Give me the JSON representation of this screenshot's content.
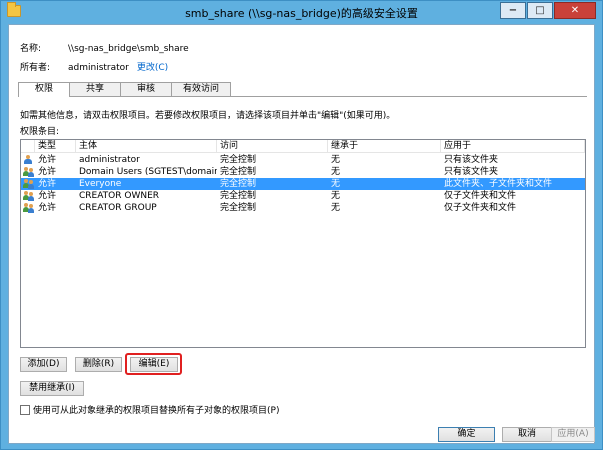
{
  "window": {
    "title": "smb_share (\\\\sg-nas_bridge)的高级安全设置",
    "minimize_label": "−",
    "maximize_label": "□",
    "close_label": "✕"
  },
  "info": {
    "name_label": "名称:",
    "name_value": "\\\\sg-nas_bridge\\smb_share",
    "owner_label": "所有者:",
    "owner_value": "administrator",
    "change_link": "更改(C)"
  },
  "tabs": [
    "权限",
    "共享",
    "审核",
    "有效访问"
  ],
  "active_tab": "权限",
  "instructions": "如需其他信息，请双击权限项目。若要修改权限项目，请选择该项目并单击\"编辑\"(如果可用)。",
  "entries_label": "权限条目:",
  "table": {
    "columns": [
      "类型",
      "主体",
      "访问",
      "继承于",
      "应用于"
    ],
    "rows": [
      {
        "icon": "user-icon",
        "type": "允许",
        "principal": "administrator",
        "access": "完全控制",
        "inherited": "无",
        "applies": "只有该文件夹"
      },
      {
        "icon": "group-icon",
        "type": "允许",
        "principal": "Domain Users (SGTEST\\domain ...",
        "access": "完全控制",
        "inherited": "无",
        "applies": "只有该文件夹"
      },
      {
        "icon": "group-icon",
        "type": "允许",
        "principal": "Everyone",
        "access": "完全控制",
        "inherited": "无",
        "applies": "此文件夹、子文件夹和文件",
        "selected": true
      },
      {
        "icon": "group-icon",
        "type": "允许",
        "principal": "CREATOR OWNER",
        "access": "完全控制",
        "inherited": "无",
        "applies": "仅子文件夹和文件"
      },
      {
        "icon": "group-icon",
        "type": "允许",
        "principal": "CREATOR GROUP",
        "access": "完全控制",
        "inherited": "无",
        "applies": "仅子文件夹和文件"
      }
    ]
  },
  "buttons": {
    "add": "添加(D)",
    "remove": "删除(R)",
    "edit": "编辑(E)",
    "disable_inheritance": "禁用继承(I)",
    "ok": "确定",
    "cancel": "取消",
    "apply": "应用(A)"
  },
  "replace_checkbox_label": "使用可从此对象继承的权限项目替换所有子对象的权限项目(P)",
  "colors": {
    "selection": "#3399ff",
    "highlight_border": "#e02020",
    "titlebar": "#5fb0e0"
  }
}
